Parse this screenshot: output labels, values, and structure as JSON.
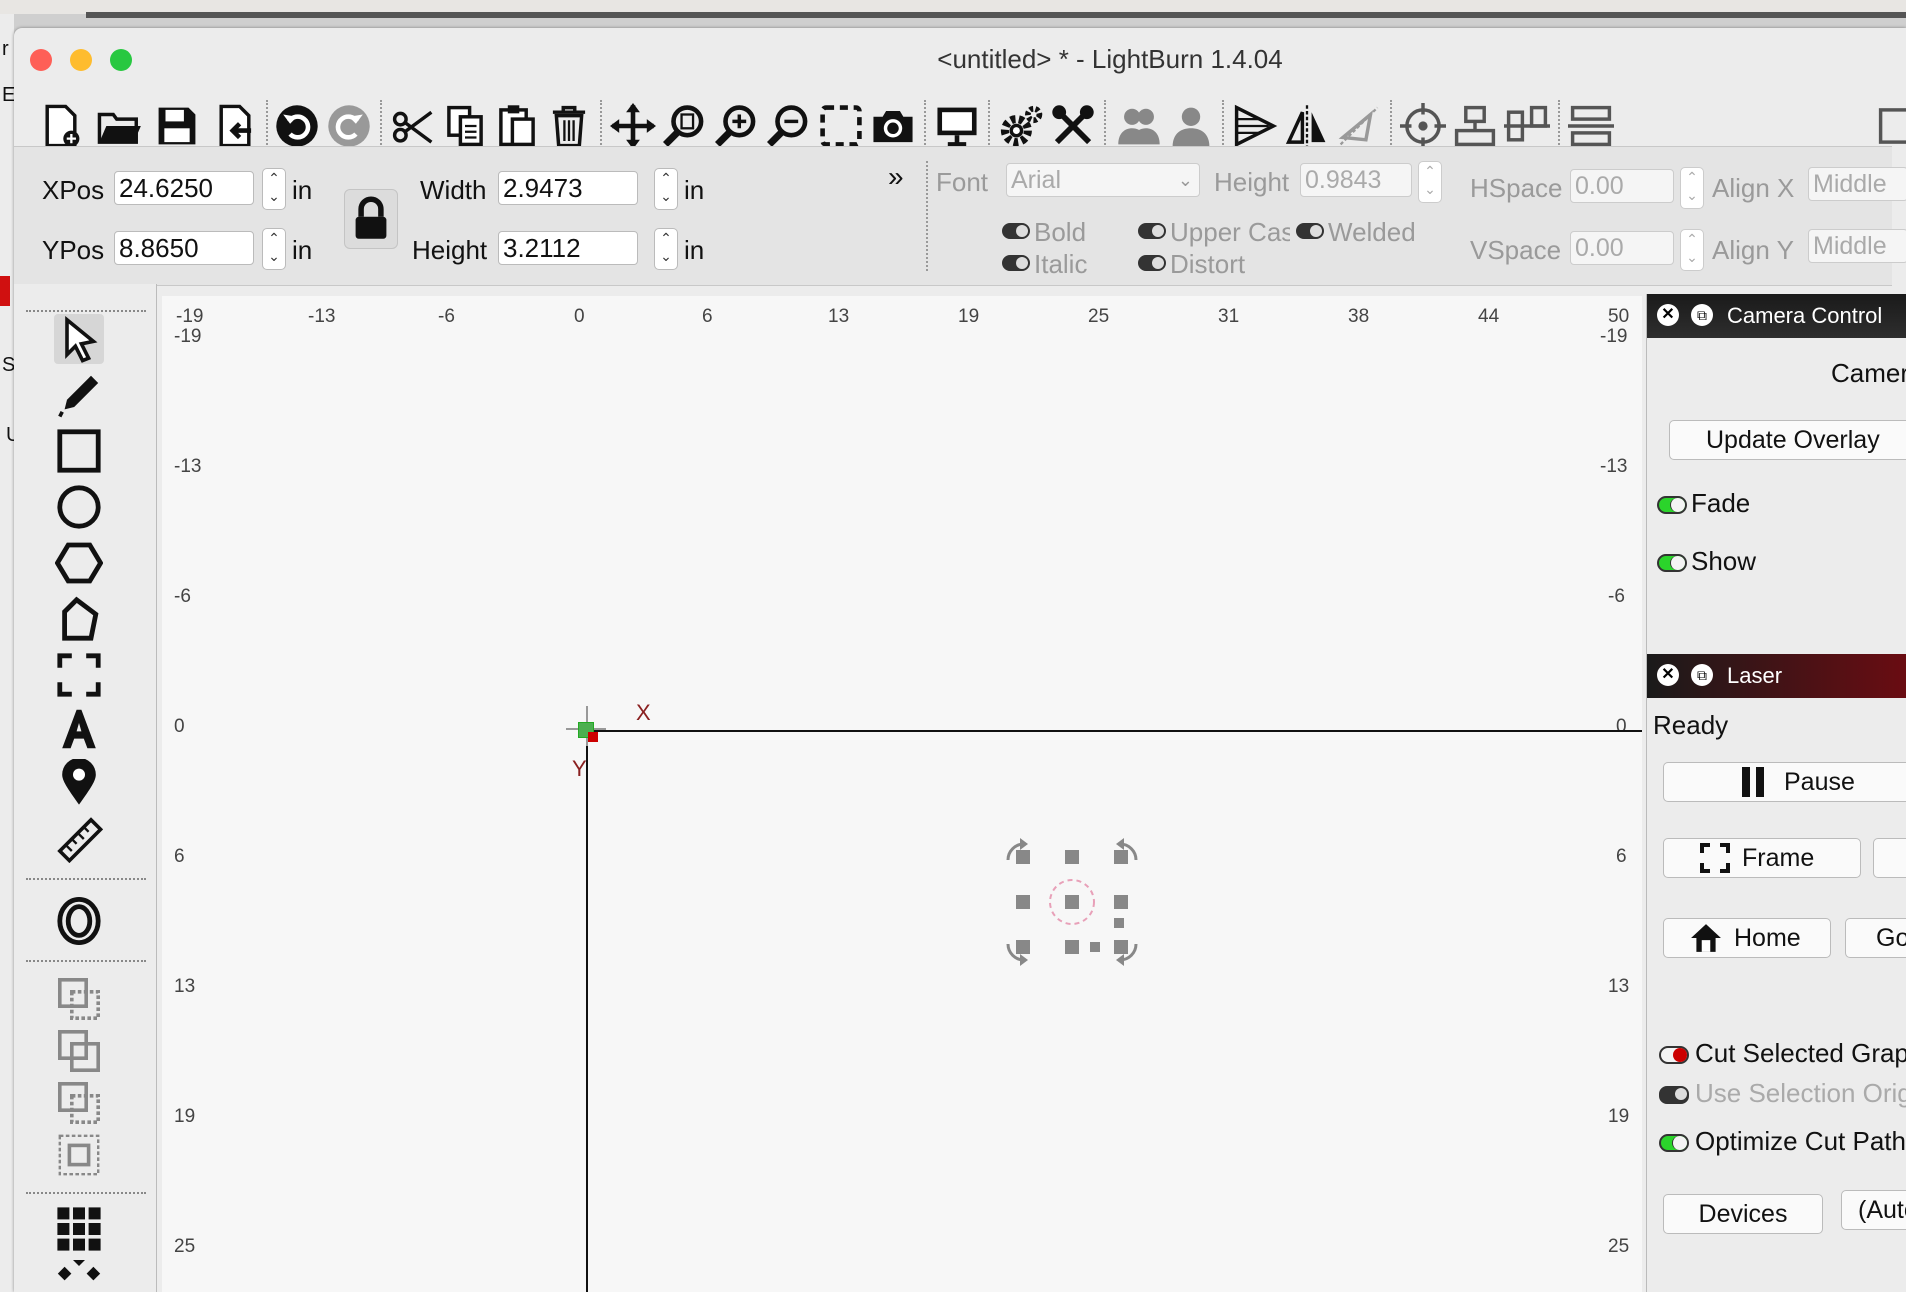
{
  "window": {
    "title": "<untitled> * - LightBurn 1.4.04"
  },
  "traffic_lights": {
    "close": "#fe5f57",
    "minimize": "#febc2e",
    "zoom": "#28c840"
  },
  "left_edge_letters": [
    "r",
    "E",
    "S",
    "U"
  ],
  "toolbar": {
    "icons": [
      "new-file",
      "open-file",
      "save",
      "import",
      "undo",
      "redo",
      "cut",
      "copy",
      "paste",
      "delete",
      "move",
      "zoom-to-page",
      "zoom-in",
      "zoom-out",
      "zoom-to-selection",
      "camera",
      "device-settings",
      "settings",
      "tools",
      "group",
      "ungroup",
      "user",
      "send",
      "mirror",
      "flip",
      "target",
      "align",
      "distribute",
      "arrange"
    ]
  },
  "props": {
    "xpos_label": "XPos",
    "xpos_value": "24.6250",
    "xpos_unit": "in",
    "ypos_label": "YPos",
    "ypos_value": "8.8650",
    "ypos_unit": "in",
    "width_label": "Width",
    "width_value": "2.9473",
    "width_unit": "in",
    "height_label": "Height",
    "height_value": "3.2112",
    "height_unit": "in",
    "expand": "»",
    "font_label": "Font",
    "font_value": "Arial",
    "font_height_label": "Height",
    "font_height_value": "0.9843",
    "hspace_label": "HSpace",
    "hspace_value": "0.00",
    "vspace_label": "VSpace",
    "vspace_value": "0.00",
    "align_x_label": "Align X",
    "align_x_value": "Middle",
    "align_y_label": "Align Y",
    "align_y_value": "Middle",
    "bold": "Bold",
    "italic": "Italic",
    "upper_case": "Upper Case",
    "welded": "Welded",
    "distort": "Distort"
  },
  "left_tools": [
    "select",
    "draw-lines",
    "rectangle",
    "ellipse",
    "polygon",
    "edit-nodes",
    "position-laser",
    "text",
    "position-marker",
    "measure",
    "offset",
    "boolean-union",
    "boolean-difference",
    "boolean-intersection",
    "weld",
    "grid-array",
    "circular-array"
  ],
  "ruler": {
    "top": [
      "-19",
      "-13",
      "-6",
      "0",
      "6",
      "13",
      "19",
      "25",
      "31",
      "38",
      "44",
      "50"
    ],
    "left": [
      "-19",
      "-13",
      "-6",
      "0",
      "6",
      "13",
      "19",
      "25"
    ],
    "right": [
      "-19",
      "-13",
      "-6",
      "0",
      "6",
      "13",
      "19",
      "25"
    ]
  },
  "canvas": {
    "x_axis_label": "X",
    "y_axis_label": "Y"
  },
  "camera_control": {
    "title": "Camera Control",
    "camera_label": "Camera",
    "update_overlay": "Update Overlay",
    "fade": "Fade",
    "show": "Show"
  },
  "laser": {
    "title": "Laser",
    "status": "Ready",
    "pause": "Pause",
    "frame": "Frame",
    "home": "Home",
    "go": "Go",
    "cut_selected": "Cut Selected Graphics",
    "use_selection_origin": "Use Selection Origin",
    "optimize": "Optimize Cut Path",
    "devices": "Devices",
    "auto": "(Auto)"
  }
}
